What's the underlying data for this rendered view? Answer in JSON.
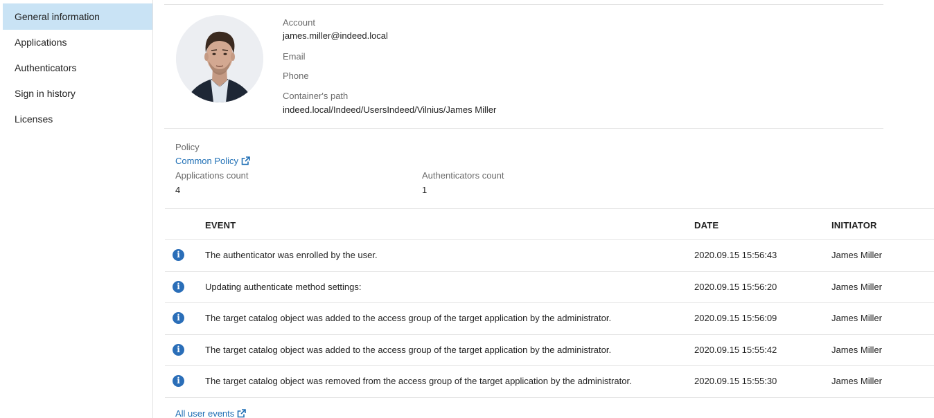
{
  "sidebar": {
    "items": [
      {
        "label": "General information",
        "active": true
      },
      {
        "label": "Applications"
      },
      {
        "label": "Authenticators"
      },
      {
        "label": "Sign in history"
      },
      {
        "label": "Licenses"
      }
    ]
  },
  "profile": {
    "account_label": "Account",
    "account_value": "james.miller@indeed.local",
    "email_label": "Email",
    "phone_label": "Phone",
    "container_label": "Container's path",
    "container_value": "indeed.local/Indeed/UsersIndeed/Vilnius/James Miller"
  },
  "policy": {
    "label": "Policy",
    "link": "Common Policy",
    "apps_label": "Applications count",
    "apps_value": "4",
    "auth_label": "Authenticators count",
    "auth_value": "1"
  },
  "events": {
    "headers": {
      "event": "EVENT",
      "date": "DATE",
      "initiator": "INITIATOR"
    },
    "rows": [
      {
        "event": "The authenticator was enrolled by the user.",
        "date": "2020.09.15 15:56:43",
        "initiator": "James Miller"
      },
      {
        "event": "Updating authenticate method settings:",
        "date": "2020.09.15 15:56:20",
        "initiator": "James Miller"
      },
      {
        "event": "The target catalog object was added to the access group of the target application by the administrator.",
        "date": "2020.09.15 15:56:09",
        "initiator": "James Miller"
      },
      {
        "event": "The target catalog object was added to the access group of the target application by the administrator.",
        "date": "2020.09.15 15:55:42",
        "initiator": "James Miller"
      },
      {
        "event": "The target catalog object was removed from the access group of the target application by the administrator.",
        "date": "2020.09.15 15:55:30",
        "initiator": "James Miller"
      }
    ],
    "all_link": "All user events"
  },
  "icons": {
    "event_icon": "info-icon",
    "link_icon": "external-link-icon",
    "avatar": "user-photo"
  },
  "colors": {
    "accent": "#1f6fb5",
    "active_nav": "#c9e3f5",
    "info": "#2a6eb8"
  }
}
